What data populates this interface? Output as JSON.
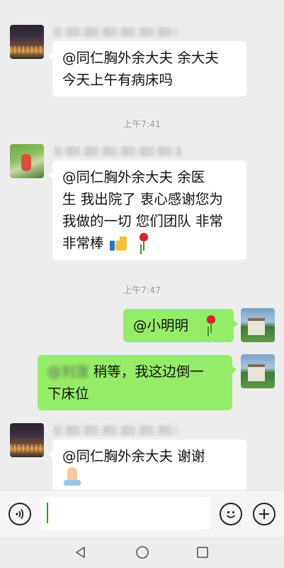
{
  "messages": [
    {
      "from": "other",
      "avatar": "city-night-avatar",
      "lines": [
        "@同仁胸外余大夫  余大夫",
        "今天上午有病床吗"
      ]
    },
    {
      "timestamp": "上午7:41"
    },
    {
      "from": "other",
      "avatar": "park-avatar",
      "lines": [
        "@同仁胸外余大夫  余医",
        "生 我出院了 衷心感谢您为",
        "我做的一切 您们团队 非常",
        "非常棒"
      ],
      "emojis": [
        "thumbs-up-icon",
        "rose-icon"
      ]
    },
    {
      "timestamp": "上午7:47"
    },
    {
      "from": "me",
      "avatar": "house-avatar",
      "lines": [
        "@小明明"
      ],
      "emojis": [
        "rose-icon"
      ]
    },
    {
      "from": "me",
      "avatar": "house-avatar",
      "mention": "@刘涨",
      "lines": [
        "  稍等，我这边倒一",
        "下床位"
      ]
    },
    {
      "from": "other",
      "avatar": "city-night-avatar",
      "lines": [
        "@同仁胸外余大夫  谢谢"
      ],
      "emojis": [
        "praying-hands-icon"
      ]
    }
  ],
  "input_bar": {
    "value": "",
    "voice_icon": "voice-icon",
    "emoji_icon": "emoji-icon",
    "more_icon": "plus-icon"
  },
  "nav": {
    "back": "back-icon",
    "home": "home-icon",
    "recents": "recents-icon"
  },
  "colors": {
    "background": "#ededed",
    "my_bubble": "#95ec69",
    "other_bubble": "#ffffff",
    "caret": "#1aad19"
  }
}
